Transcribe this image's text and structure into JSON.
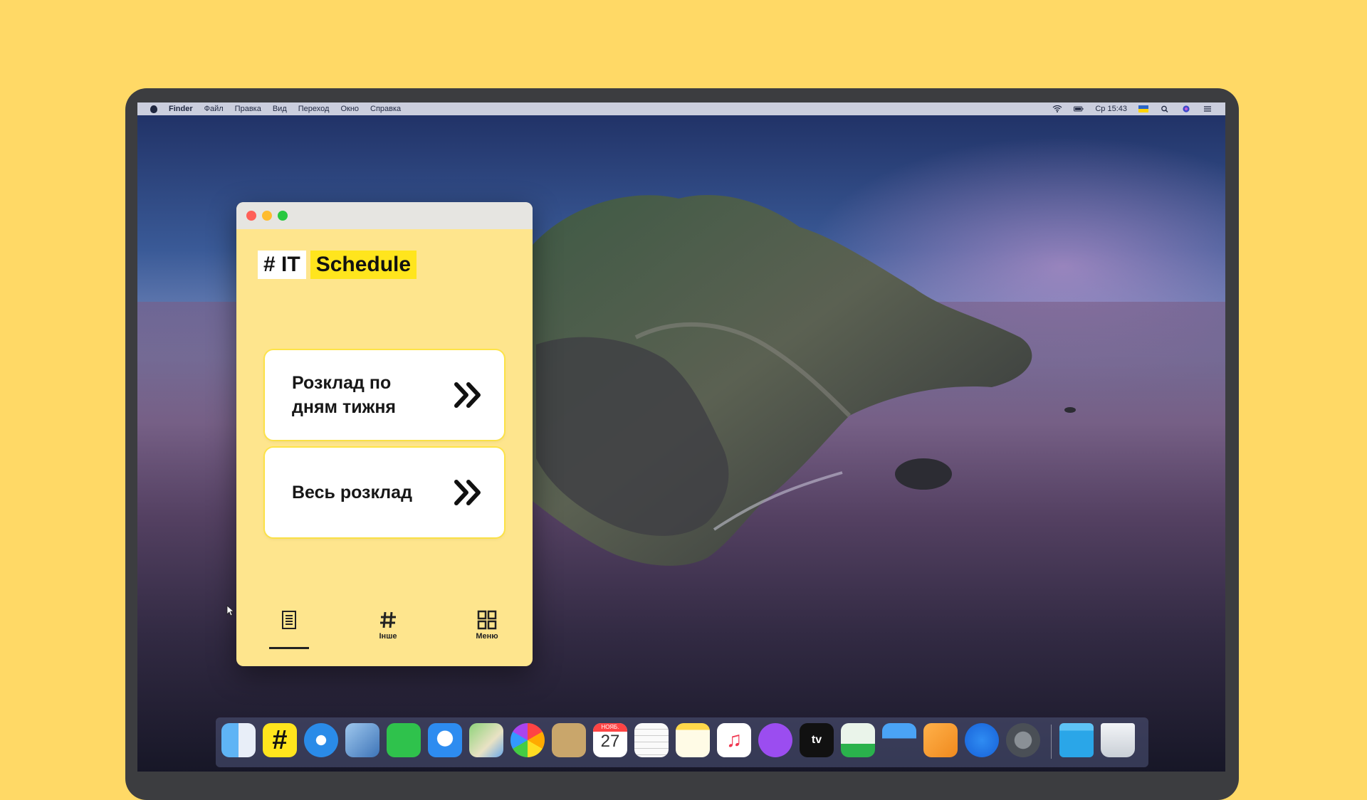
{
  "menubar": {
    "items": [
      "Finder",
      "Файл",
      "Правка",
      "Вид",
      "Переход",
      "Окно",
      "Справка"
    ],
    "clock": "Ср 15:43"
  },
  "app": {
    "logo_hash": "# IT",
    "logo_word": "Schedule",
    "cards": [
      {
        "label": "Розклад по\nдням тижня"
      },
      {
        "label": "Весь розклад"
      }
    ],
    "tabs": [
      {
        "label": "",
        "icon": "document-icon",
        "active": true
      },
      {
        "label": "Інше",
        "icon": "hash-icon",
        "active": false
      },
      {
        "label": "Меню",
        "icon": "grid-icon",
        "active": false
      }
    ]
  },
  "dock": {
    "calendar_month": "НОЯБ.",
    "calendar_day": "27",
    "tv_label": "tv",
    "apps": [
      "finder-icon",
      "it-schedule-icon",
      "safari-icon",
      "preview-icon",
      "facetime-icon",
      "messages-icon",
      "maps-icon",
      "photos-icon",
      "contacts-icon",
      "calendar-icon",
      "reminders-icon",
      "notes-icon",
      "music-icon",
      "podcasts-icon",
      "tv-icon",
      "numbers-icon",
      "keynote-icon",
      "pages-icon",
      "app-store-icon",
      "system-preferences-icon",
      "downloads-folder-icon",
      "trash-icon"
    ]
  },
  "colors": {
    "background": "#ffd966",
    "app_bg": "#fee58d",
    "accent": "#ffe51d"
  }
}
